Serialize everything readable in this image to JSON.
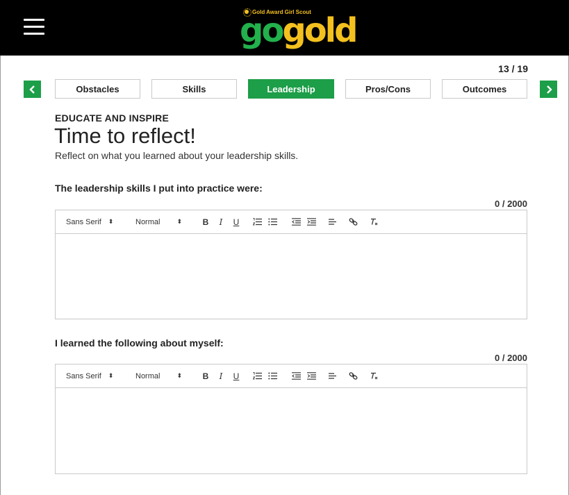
{
  "header": {
    "logo_tag": "Gold Award Girl Scout",
    "logo_go": "go",
    "logo_gold": "gold",
    "menu_icon": "hamburger-menu-icon"
  },
  "progress": {
    "text": "13 / 19",
    "current": 13,
    "total": 19
  },
  "tabs": [
    {
      "label": "Obstacles",
      "active": false
    },
    {
      "label": "Skills",
      "active": false
    },
    {
      "label": "Leadership",
      "active": true
    },
    {
      "label": "Pros/Cons",
      "active": false
    },
    {
      "label": "Outcomes",
      "active": false
    }
  ],
  "nav": {
    "prev_icon": "chevron-left-icon",
    "next_icon": "chevron-right-icon"
  },
  "content": {
    "eyebrow": "EDUCATE AND INSPIRE",
    "title": "Time to reflect!",
    "subtitle": "Reflect on what you learned about your leadership skills."
  },
  "toolbar": {
    "font_value": "Sans Serif",
    "size_value": "Normal",
    "select_arrows": "⬍"
  },
  "questions": [
    {
      "label": "The leadership skills I put into practice were:",
      "count": "0 / 2000",
      "value": ""
    },
    {
      "label": "I learned the following about myself:",
      "count": "0 / 2000",
      "value": ""
    }
  ],
  "colors": {
    "brand_green": "#1d9e48",
    "logo_green": "#22b14c",
    "logo_gold": "#f4c01e",
    "header_bg": "#000000"
  }
}
